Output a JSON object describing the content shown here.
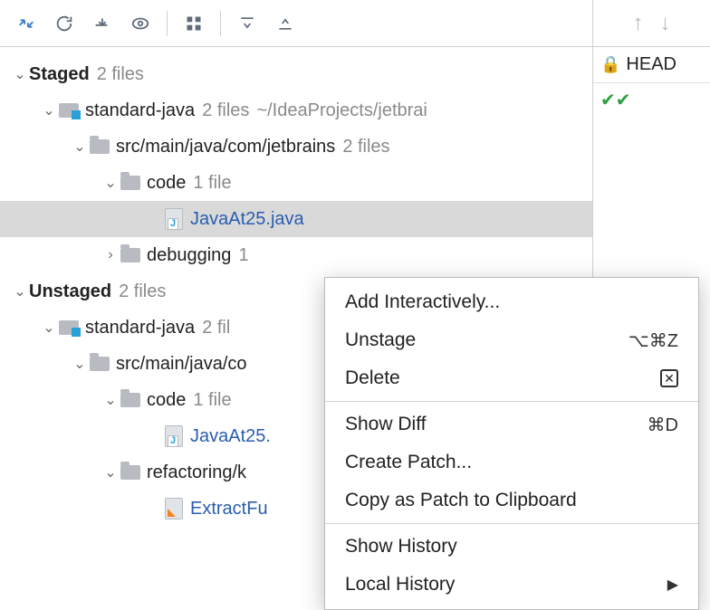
{
  "toolbar": {},
  "side": {
    "head": "HEAD"
  },
  "staged": {
    "title": "Staged",
    "count": "2 files",
    "module": {
      "name": "standard-java",
      "count": "2 files",
      "path": "~/IdeaProjects/jetbrai"
    },
    "src": {
      "path": "src/main/java/com/jetbrains",
      "count": "2 files"
    },
    "code": {
      "name": "code",
      "count": "1 file"
    },
    "file1": "JavaAt25.java",
    "debugging": {
      "name": "debugging",
      "count": "1"
    }
  },
  "unstaged": {
    "title": "Unstaged",
    "count": "2 files",
    "module": {
      "name": "standard-java",
      "count": "2 fil"
    },
    "src": {
      "path": "src/main/java/co"
    },
    "code": {
      "name": "code",
      "count": "1 file"
    },
    "file1": "JavaAt25.",
    "refactoring": {
      "name": "refactoring/k"
    },
    "file2": "ExtractFu"
  },
  "ctx": {
    "addInteractively": "Add Interactively...",
    "unstage": "Unstage",
    "unstage_sc": "⌥⌘Z",
    "delete": "Delete",
    "showDiff": "Show Diff",
    "showDiff_sc": "⌘D",
    "createPatch": "Create Patch...",
    "copyPatch": "Copy as Patch to Clipboard",
    "showHistory": "Show History",
    "localHistory": "Local History"
  }
}
